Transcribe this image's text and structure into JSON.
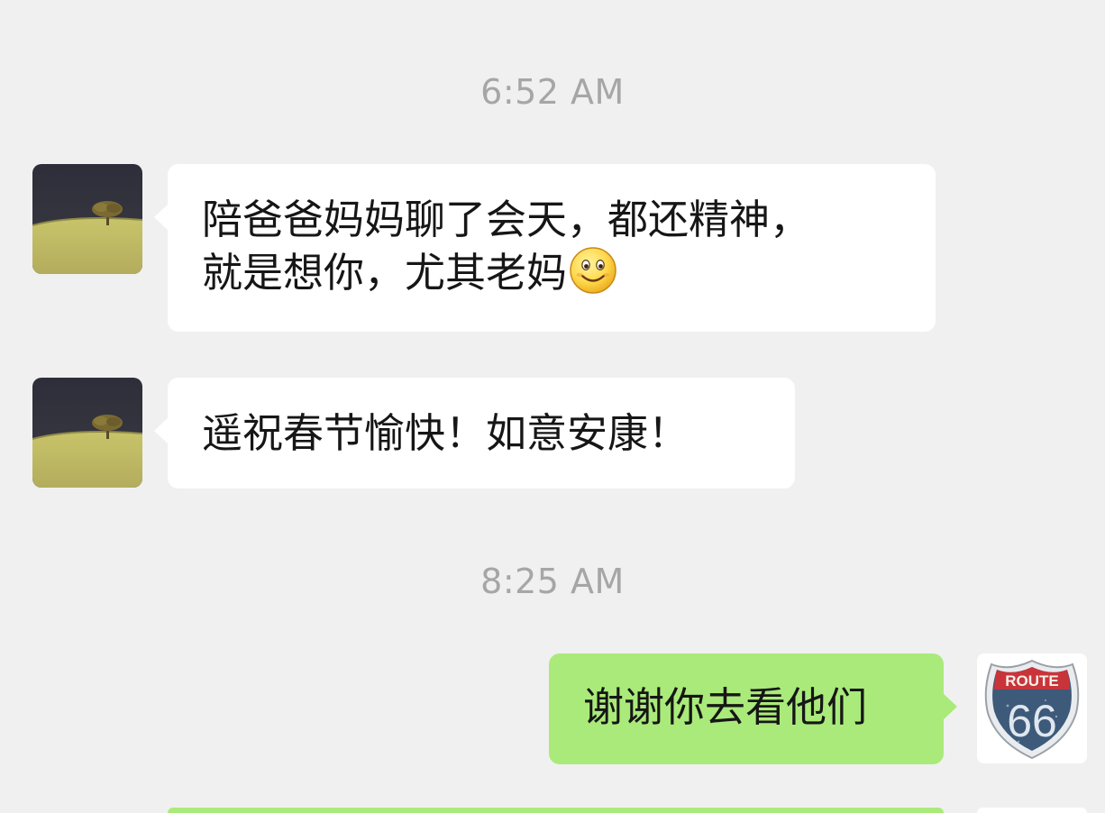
{
  "conversation": {
    "timestamps": [
      "6:52 AM",
      "8:25 AM"
    ],
    "messages": [
      {
        "direction": "incoming",
        "avatar": "landscape-tree-avatar",
        "lines": [
          "陪爸爸妈妈聊了会天，都还精神，",
          "就是想你，尤其老妈"
        ],
        "emoji": "smile-emoji"
      },
      {
        "direction": "incoming",
        "avatar": "landscape-tree-avatar",
        "lines": [
          "遥祝春节愉快！如意安康！"
        ]
      },
      {
        "direction": "outgoing",
        "avatar": "route-66-avatar",
        "avatar_text": {
          "top": "ROUTE",
          "number": "66"
        },
        "lines": [
          "谢谢你去看他们"
        ]
      }
    ]
  },
  "colors": {
    "background": "#f0f0f0",
    "incoming_bubble": "#ffffff",
    "outgoing_bubble": "#a9ea7a",
    "timestamp_text": "#a6a6a6",
    "message_text": "#161616"
  }
}
